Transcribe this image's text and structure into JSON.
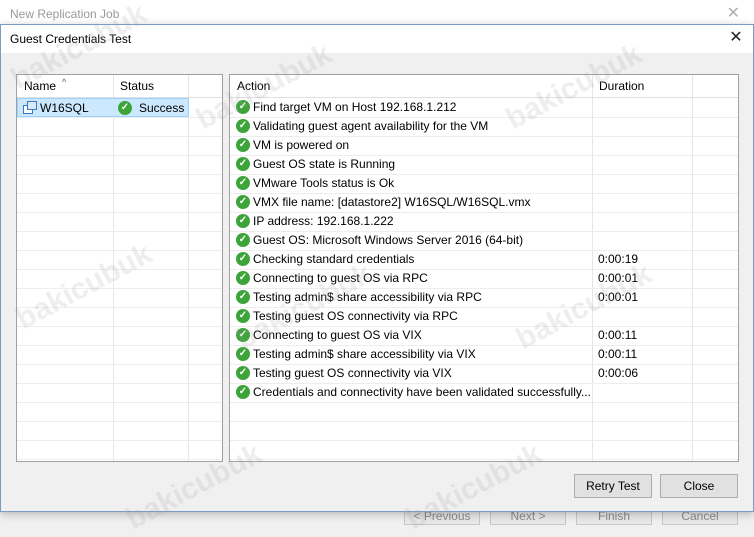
{
  "parent_window": {
    "title": "New Replication Job",
    "buttons": [
      "< Previous",
      "Next >",
      "Finish",
      "Cancel"
    ]
  },
  "dialog": {
    "title": "Guest Credentials Test",
    "buttons": {
      "retry": "Retry Test",
      "close": "Close"
    }
  },
  "vm_list": {
    "columns": [
      "Name",
      "Status"
    ],
    "items": [
      {
        "name": "W16SQL",
        "status": "Success"
      }
    ]
  },
  "action_list": {
    "columns": [
      "Action",
      "Duration"
    ],
    "rows": [
      {
        "action": "Find target VM on Host 192.168.1.212",
        "duration": ""
      },
      {
        "action": "Validating guest agent availability for the VM",
        "duration": ""
      },
      {
        "action": "VM is powered on",
        "duration": ""
      },
      {
        "action": "Guest OS state is Running",
        "duration": ""
      },
      {
        "action": "VMware Tools status is Ok",
        "duration": ""
      },
      {
        "action": "VMX file name: [datastore2] W16SQL/W16SQL.vmx",
        "duration": ""
      },
      {
        "action": "IP address: 192.168.1.222",
        "duration": ""
      },
      {
        "action": "Guest OS: Microsoft Windows Server 2016 (64-bit)",
        "duration": ""
      },
      {
        "action": "Checking standard credentials",
        "duration": "0:00:19"
      },
      {
        "action": "Connecting to guest OS via RPC",
        "duration": "0:00:01"
      },
      {
        "action": "Testing admin$ share accessibility via RPC",
        "duration": "0:00:01"
      },
      {
        "action": "Testing guest OS connectivity via RPC",
        "duration": ""
      },
      {
        "action": "Connecting to guest OS via VIX",
        "duration": "0:00:11"
      },
      {
        "action": "Testing admin$ share accessibility via VIX",
        "duration": "0:00:11"
      },
      {
        "action": "Testing guest OS connectivity via VIX",
        "duration": "0:00:06"
      },
      {
        "action": "Credentials and connectivity have been validated successfully...",
        "duration": ""
      }
    ]
  },
  "watermark": "bakicubuk",
  "colors": {
    "success": "#3da43a",
    "selection": "#cce8ff"
  }
}
